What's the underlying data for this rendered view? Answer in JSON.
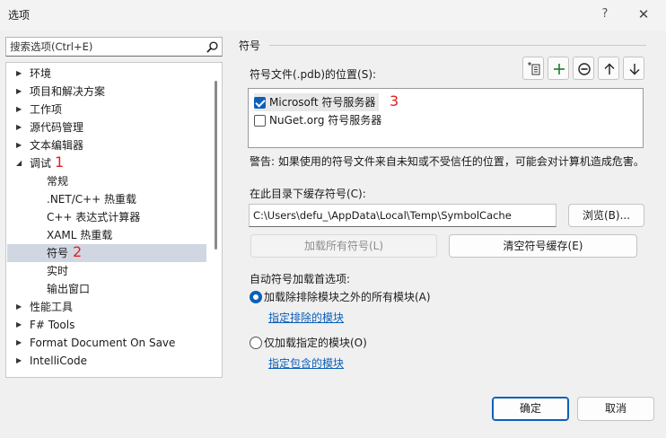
{
  "window": {
    "title": "选项",
    "help_label": "?",
    "close_label": "✕"
  },
  "search": {
    "placeholder": "搜索选项(Ctrl+E)"
  },
  "tree": {
    "items": [
      {
        "label": "环境",
        "arrow": "▶"
      },
      {
        "label": "项目和解决方案",
        "arrow": "▶"
      },
      {
        "label": "工作项",
        "arrow": "▶"
      },
      {
        "label": "源代码管理",
        "arrow": "▶"
      },
      {
        "label": "文本编辑器",
        "arrow": "▶"
      },
      {
        "label": "调试",
        "arrow": "◢"
      },
      {
        "label": "常规"
      },
      {
        "label": ".NET/C++ 热重载"
      },
      {
        "label": "C++ 表达式计算器"
      },
      {
        "label": "XAML 热重载"
      },
      {
        "label": "符号"
      },
      {
        "label": "实时"
      },
      {
        "label": "输出窗口"
      },
      {
        "label": "性能工具",
        "arrow": "▶"
      },
      {
        "label": "F# Tools",
        "arrow": "▶"
      },
      {
        "label": "Format Document On Save",
        "arrow": "▶"
      },
      {
        "label": "IntelliCode",
        "arrow": "▶"
      }
    ]
  },
  "annotations": {
    "n1": "1",
    "n2": "2",
    "n3": "3"
  },
  "panel": {
    "section_title": "符号",
    "locations_label": "符号文件(.pdb)的位置(S):",
    "servers": [
      {
        "label": "Microsoft 符号服务器",
        "checked": true
      },
      {
        "label": "NuGet.org 符号服务器",
        "checked": false
      }
    ],
    "warning": "警告: 如果使用的符号文件来自未知或不受信任的位置，可能会对计算机造成危害。",
    "cache_label": "在此目录下缓存符号(C):",
    "cache_path": "C:\\Users\\defu_\\AppData\\Local\\Temp\\SymbolCache",
    "browse_label": "浏览(B)...",
    "load_all_label": "加载所有符号(L)",
    "clear_cache_label": "清空符号缓存(E)",
    "auto_label": "自动符号加载首选项:",
    "option_all": "加载除排除模块之外的所有模块(A)",
    "link_excluded": "指定排除的模块",
    "option_specified": "仅加载指定的模块(O)",
    "link_included": "指定包含的模块"
  },
  "footer": {
    "ok_label": "确定",
    "cancel_label": "取消"
  },
  "colors": {
    "accent": "#0b5fb8",
    "annotation": "#e02020",
    "selection": "#d0d7e2"
  }
}
